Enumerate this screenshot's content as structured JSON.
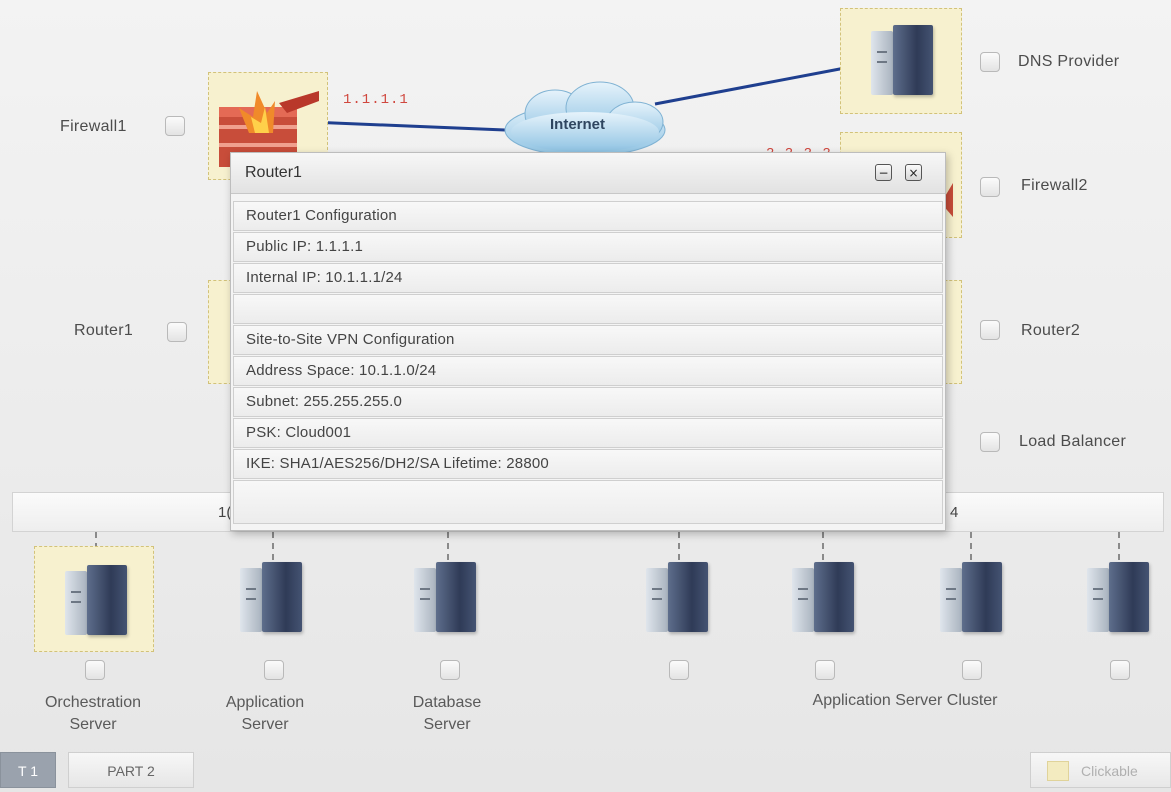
{
  "topology": {
    "firewall1_label": "Firewall1",
    "firewall1_ip": "1.1.1.1",
    "internet_label": "Internet",
    "dns_provider_label": "DNS Provider",
    "firewall2_label": "Firewall2",
    "firewall2_ip_partial": "2.2.2.2",
    "router1_label": "Router1",
    "router2_label": "Router2",
    "load_balancer_label": "Load Balancer",
    "bus_left_text": "1(",
    "bus_right_text": "4"
  },
  "servers": [
    {
      "label_line1": "Orchestration",
      "label_line2": "Server"
    },
    {
      "label_line1": "Application",
      "label_line2": "Server"
    },
    {
      "label_line1": "Database",
      "label_line2": "Server"
    }
  ],
  "cluster_label": "Application Server Cluster",
  "popup": {
    "title": "Router1",
    "minimize_symbol": "−",
    "close_symbol": "×",
    "rows": [
      "Router1 Configuration",
      "Public IP: 1.1.1.1",
      "Internal IP: 10.1.1.1/24",
      "",
      "Site-to-Site VPN Configuration",
      "Address Space: 10.1.1.0/24",
      "Subnet: 255.255.255.0",
      "PSK: Cloud001",
      "IKE: SHA1/AES256/DH2/SA Lifetime: 28800",
      ""
    ]
  },
  "tabs": {
    "part1": "T 1",
    "part2": "PART 2",
    "clickable": "Clickable"
  },
  "colors": {
    "highlight_box": "#f7f1cf",
    "link_line": "#1f3f8f",
    "ip_text": "#d0473e"
  }
}
